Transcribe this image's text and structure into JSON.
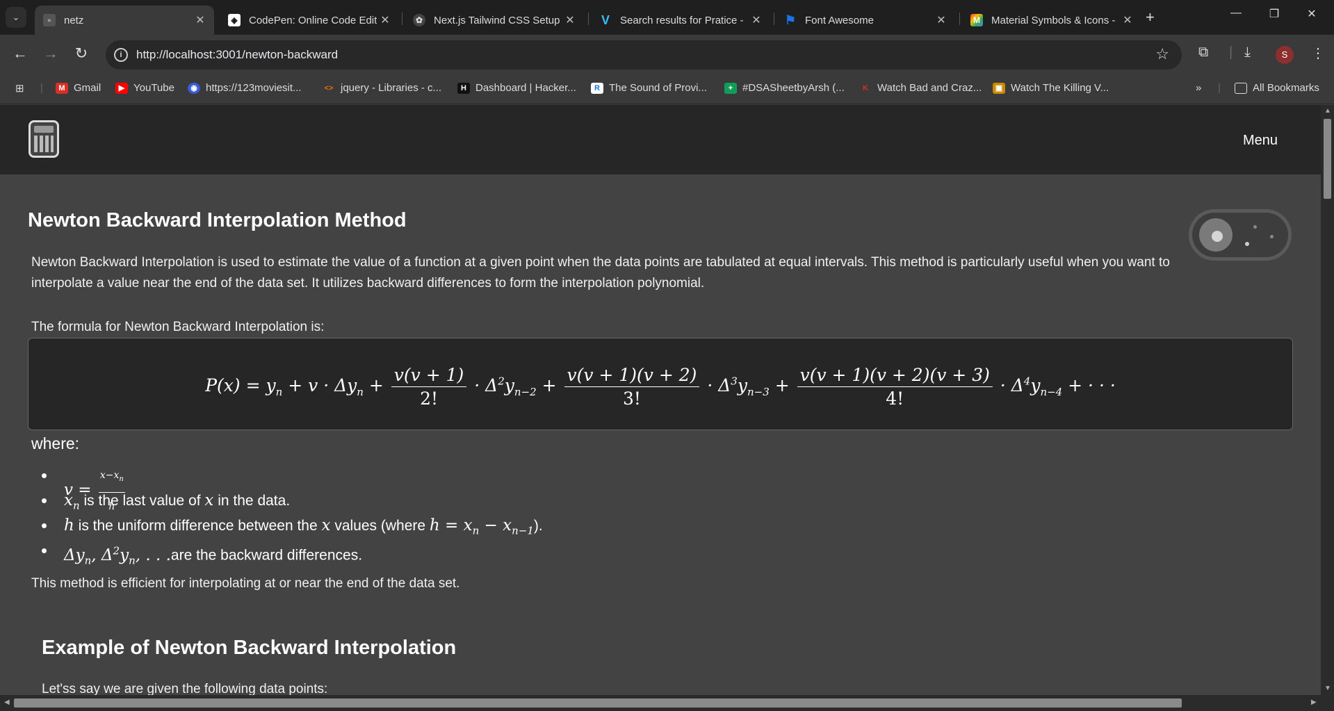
{
  "browser": {
    "tabs": [
      {
        "title": "netz",
        "active": true
      },
      {
        "title": "CodePen: Online Code Edit",
        "active": false
      },
      {
        "title": "Next.js Tailwind CSS Setup",
        "active": false
      },
      {
        "title": "Search results for Pratice -",
        "active": false
      },
      {
        "title": "Font Awesome",
        "active": false
      },
      {
        "title": "Material Symbols & Icons -",
        "active": false
      }
    ],
    "url": "http://localhost:3001/newton-backward",
    "profile_initial": "S",
    "bookmarks": [
      {
        "label": "Gmail",
        "icon": "gmail-icon",
        "color": "#d93025"
      },
      {
        "label": "YouTube",
        "icon": "youtube-icon",
        "color": "#ff0000"
      },
      {
        "label": "https://123moviesit...",
        "icon": "film-reel-icon",
        "color": "#3b5bdb"
      },
      {
        "label": "jquery - Libraries - c...",
        "icon": "code-icon",
        "color": "#e8710a"
      },
      {
        "label": "Dashboard | Hacker...",
        "icon": "hackerrank-icon",
        "color": "#111111"
      },
      {
        "label": "The Sound of Provi...",
        "icon": "r-icon",
        "color": "#1a73e8"
      },
      {
        "label": "#DSASheetbyArsh (...",
        "icon": "sheets-plus-icon",
        "color": "#0f9d58"
      },
      {
        "label": "Watch Bad and Craz...",
        "icon": "k-icon",
        "color": "#d93025"
      },
      {
        "label": "Watch The Killing V...",
        "icon": "tv-icon",
        "color": "#c98a00"
      }
    ],
    "all_bookmarks_label": "All Bookmarks"
  },
  "site": {
    "menu_label": "Menu"
  },
  "content": {
    "title": "Newton Backward Interpolation Method",
    "intro": "Newton Backward Interpolation is used to estimate the value of a function at a given point when the data points are tabulated at equal intervals. This method is particularly useful when you want to interpolate a value near the end of the data set. It utilizes backward differences to form the interpolation polynomial.",
    "formula_intro": "The formula for Newton Backward Interpolation is:",
    "where_label": "where:",
    "def_xn_text": " is the last value of ",
    "def_xn_text2": " in the data.",
    "def_h_text": " is the uniform difference between the ",
    "def_h_text2": " values (where ",
    "def_h_text3": ").",
    "def_delta_text": "are the backward differences.",
    "efficiency": "This method is efficient for interpolating at or near the end of the data set.",
    "example_title": "Example of Newton Backward Interpolation",
    "example_intro": "Let'ss say we are given the following data points:"
  }
}
